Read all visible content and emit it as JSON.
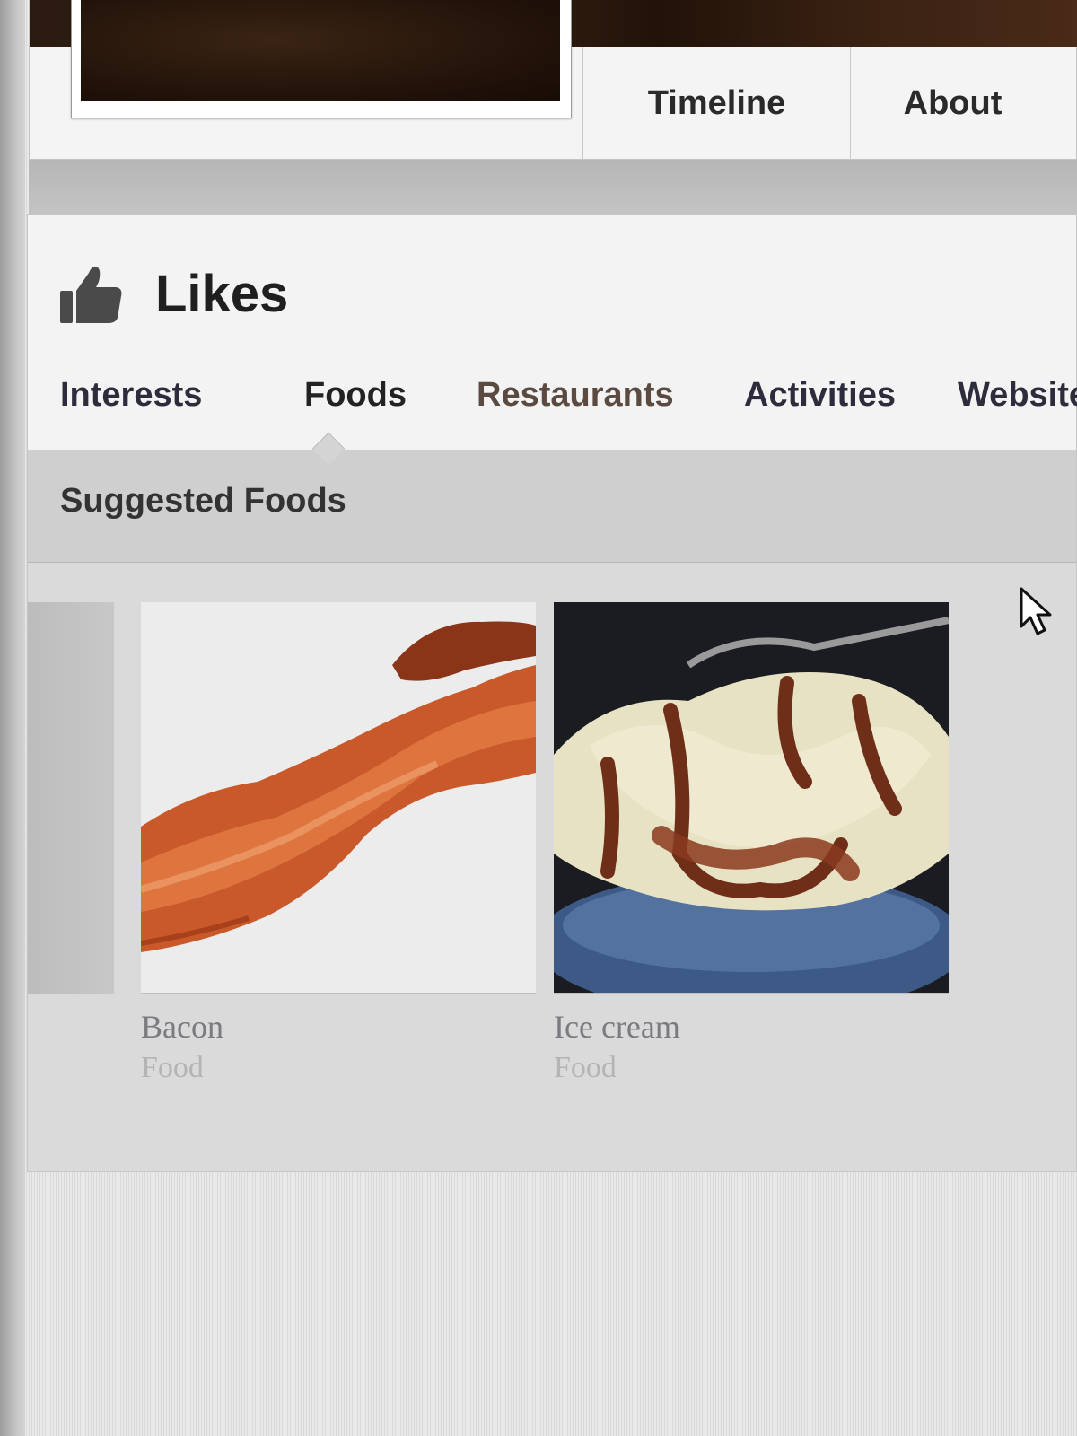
{
  "profile": {
    "nav_tabs": [
      {
        "label": "Timeline"
      },
      {
        "label": "About"
      }
    ]
  },
  "likes": {
    "title": "Likes",
    "icon": "thumbs-up-icon",
    "categories": [
      {
        "label": "Interests"
      },
      {
        "label": "Foods",
        "active": true
      },
      {
        "label": "Restaurants"
      },
      {
        "label": "Activities"
      },
      {
        "label": "Website"
      }
    ],
    "suggested_title": "Suggested Foods",
    "suggestions": [
      {
        "name": "Bacon",
        "type": "Food"
      },
      {
        "name": "Ice cream",
        "type": "Food"
      }
    ]
  },
  "cursor": {
    "icon": "mouse-pointer-icon"
  }
}
